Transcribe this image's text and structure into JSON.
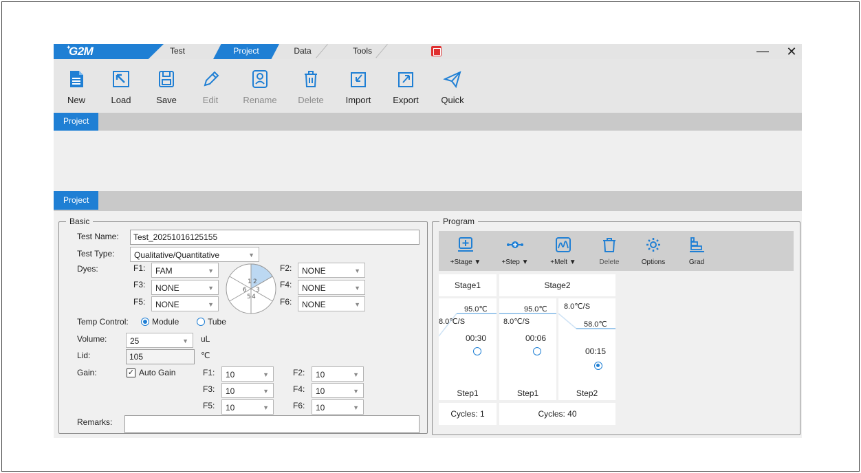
{
  "app": {
    "logo": "G2M",
    "tabs": [
      {
        "label": "Test",
        "active": false
      },
      {
        "label": "Project",
        "active": true
      },
      {
        "label": "Data",
        "active": false
      },
      {
        "label": "Tools",
        "active": false
      }
    ],
    "accent_color": "#1f7fd4"
  },
  "toolbar": {
    "new": "New",
    "load": "Load",
    "save": "Save",
    "edit": "Edit",
    "rename": "Rename",
    "delete": "Delete",
    "import": "Import",
    "export": "Export",
    "quick": "Quick"
  },
  "sections": {
    "top_project": "Project",
    "bottom_project": "Project"
  },
  "basic": {
    "title": "Basic",
    "test_name_label": "Test Name:",
    "test_name_value": "Test_20251016125155",
    "test_type_label": "Test Type:",
    "test_type_value": "Qualitative/Quantitative",
    "dyes_label": "Dyes:",
    "dyes": {
      "f1_label": "F1:",
      "f1": "FAM",
      "f2_label": "F2:",
      "f2": "NONE",
      "f3_label": "F3:",
      "f3": "NONE",
      "f4_label": "F4:",
      "f4": "NONE",
      "f5_label": "F5:",
      "f5": "NONE",
      "f6_label": "F6:",
      "f6": "NONE"
    },
    "wheel_numbers": [
      "1",
      "2",
      "3",
      "4",
      "5",
      "6"
    ],
    "temp_control_label": "Temp Control:",
    "temp_module": "Module",
    "temp_tube": "Tube",
    "volume_label": "Volume:",
    "volume_value": "25",
    "volume_unit": "uL",
    "lid_label": "Lid:",
    "lid_value": "105",
    "lid_unit": "℃",
    "gain_label": "Gain:",
    "auto_gain": "Auto Gain",
    "gains": {
      "f1_label": "F1:",
      "f1": "10",
      "f2_label": "F2:",
      "f2": "10",
      "f3_label": "F3:",
      "f3": "10",
      "f4_label": "F4:",
      "f4": "10",
      "f5_label": "F5:",
      "f5": "10",
      "f6_label": "F6:",
      "f6": "10"
    },
    "remarks_label": "Remarks:",
    "remarks_value": ""
  },
  "program": {
    "title": "Program",
    "tools": {
      "add_stage": "+Stage ▼",
      "add_step": "+Step ▼",
      "add_melt": "+Melt ▼",
      "delete": "Delete",
      "options": "Options",
      "grad": "Grad"
    },
    "stage1": {
      "name": "Stage1",
      "temp": "95.0℃",
      "rate": "8.0℃/S",
      "time": "00:30",
      "step": "Step1",
      "cycles": "Cycles:  1"
    },
    "stage2": {
      "name": "Stage2",
      "step1": {
        "temp": "95.0℃",
        "rate": "8.0℃/S",
        "time": "00:06",
        "label": "Step1"
      },
      "step2": {
        "temp": "58.0℃",
        "rate": "8.0℃/S",
        "time": "00:15",
        "label": "Step2"
      },
      "cycles": "Cycles:  40"
    }
  }
}
